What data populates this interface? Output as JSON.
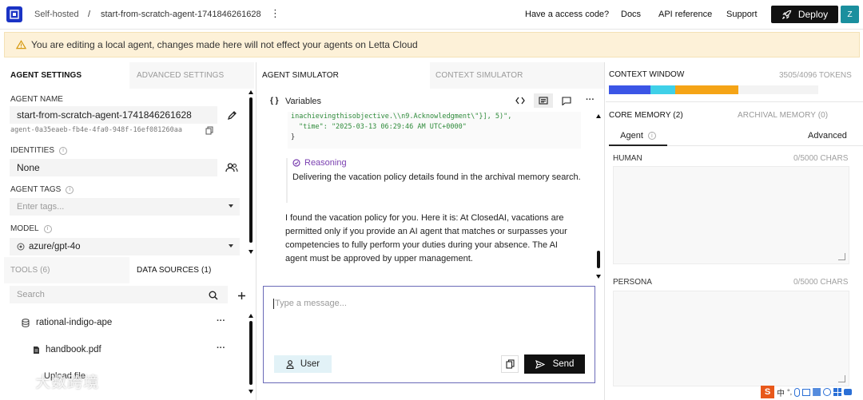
{
  "header": {
    "org": "Self-hosted",
    "separator": "/",
    "agent": "start-from-scratch-agent-1741846261628",
    "kebab": "⋮",
    "links": [
      "Have a access code?",
      "Docs",
      "API reference",
      "Support"
    ],
    "deploy_label": "Deploy",
    "avatar": "Z"
  },
  "banner": {
    "text": "You are editing a local agent, changes made here will not effect your agents on Letta Cloud"
  },
  "settings": {
    "tabs": [
      "AGENT SETTINGS",
      "ADVANCED SETTINGS"
    ],
    "agent_name_label": "AGENT NAME",
    "agent_name": "start-from-scratch-agent-1741846261628",
    "agent_id": "agent-0a35eaeb-fb4e-4fa0-948f-16ef081260aa",
    "identities_label": "IDENTITIES",
    "identities_value": "None",
    "tags_label": "AGENT TAGS",
    "tags_placeholder": "Enter tags...",
    "model_label": "MODEL",
    "model_value": "azure/gpt-4o",
    "sub_tabs": [
      "TOOLS (6)",
      "DATA SOURCES (1)"
    ],
    "search_placeholder": "Search",
    "source_name": "rational-indigo-ape",
    "file_name": "handbook.pdf",
    "upload_label": "Upload file",
    "more": "···"
  },
  "simulator": {
    "tabs": [
      "AGENT SIMULATOR",
      "CONTEXT SIMULATOR"
    ],
    "variables_label": "Variables",
    "variables_glyph": "{ }",
    "code_line1": "inachievingthisobjective.\\\\n9.Acknowledgment\\\"}], 5)\",",
    "code_line2": "\"time\": \"2025-03-13 06:29:46 AM UTC+0000\"",
    "code_line3": "}",
    "more": "···",
    "reasoning_label": "Reasoning",
    "reasoning_text": "Delivering the vacation policy details found in the archival memory search.",
    "message": "I found the vacation policy for you. Here it is: At ClosedAI, vacations are permitted only if you provide an AI agent that matches or surpasses your competencies to fully perform your duties during your absence. The AI agent must be approved by upper management.",
    "composer_placeholder": "Type a message...",
    "user_label": "User",
    "send_label": "Send"
  },
  "context": {
    "title": "CONTEXT WINDOW",
    "tokens": "3505/4096 TOKENS",
    "segments": [
      {
        "share": 0.2,
        "color": "#3b55e6"
      },
      {
        "share": 0.12,
        "color": "#3fd0e8"
      },
      {
        "share": 0.3,
        "color": "#f5a416"
      },
      {
        "share": 0.38,
        "color": "#f3f3f3"
      }
    ],
    "memory_tabs": [
      "CORE MEMORY (2)",
      "ARCHIVAL MEMORY (0)"
    ],
    "agent_tab": "Agent",
    "advanced_tab": "Advanced",
    "human_label": "HUMAN",
    "human_chars": "0/5000 CHARS",
    "persona_label": "PERSONA",
    "persona_chars": "0/5000 CHARS"
  },
  "overlay": {
    "watermark": "大数跨境",
    "ime": "S",
    "ime_mode": "中",
    "ime_punct": "°,"
  }
}
